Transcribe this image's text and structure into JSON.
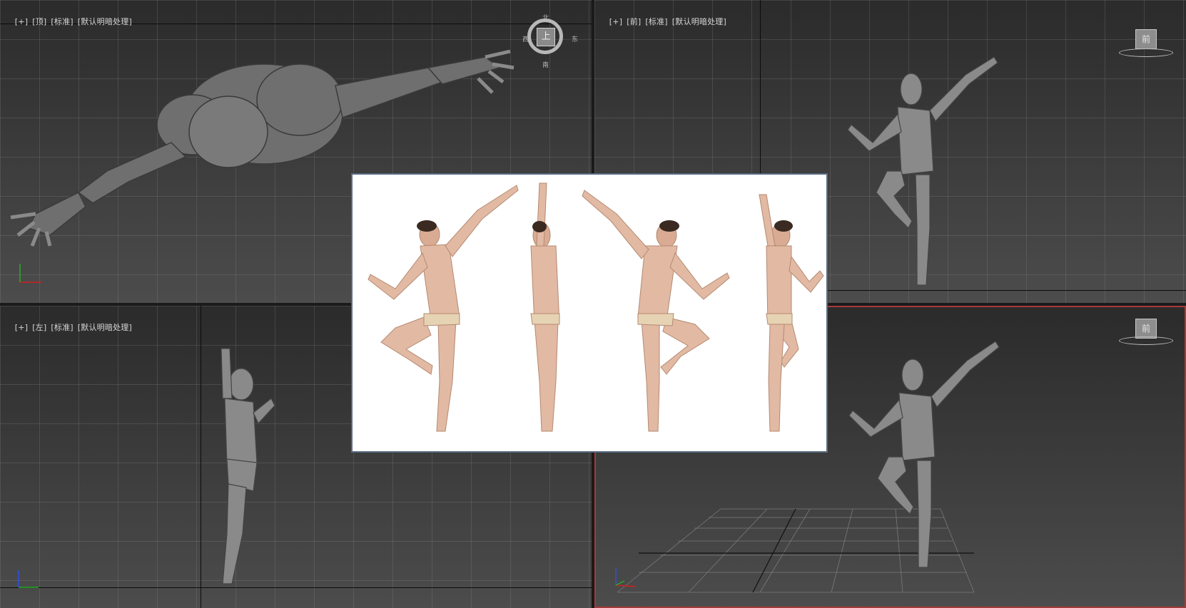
{
  "viewports": {
    "top": {
      "plus": "[+]",
      "view": "[顶]",
      "mode": "[标准]",
      "shading": "[默认明暗处理]"
    },
    "front": {
      "plus": "[+]",
      "view": "[前]",
      "mode": "[标准]",
      "shading": "[默认明暗处理]"
    },
    "left": {
      "plus": "[+]",
      "view": "[左]",
      "mode": "[标准]",
      "shading": "[默认明暗处理]"
    },
    "perspective": {
      "active": true
    }
  },
  "viewcube_top": {
    "face": "上",
    "north": "北",
    "south": "南",
    "west": "西",
    "east": "东"
  },
  "viewcube_front": {
    "face": "前"
  },
  "viewcube_persp": {
    "face": "前"
  },
  "gizmo": {
    "x": "x",
    "y": "y",
    "z": "z"
  },
  "colors": {
    "active_border": "#a63a3a",
    "axis_x": "#d02020",
    "axis_y": "#20b020",
    "axis_z": "#3050e0"
  },
  "reference_image": {
    "description_icon": "photo-reference-icon"
  }
}
